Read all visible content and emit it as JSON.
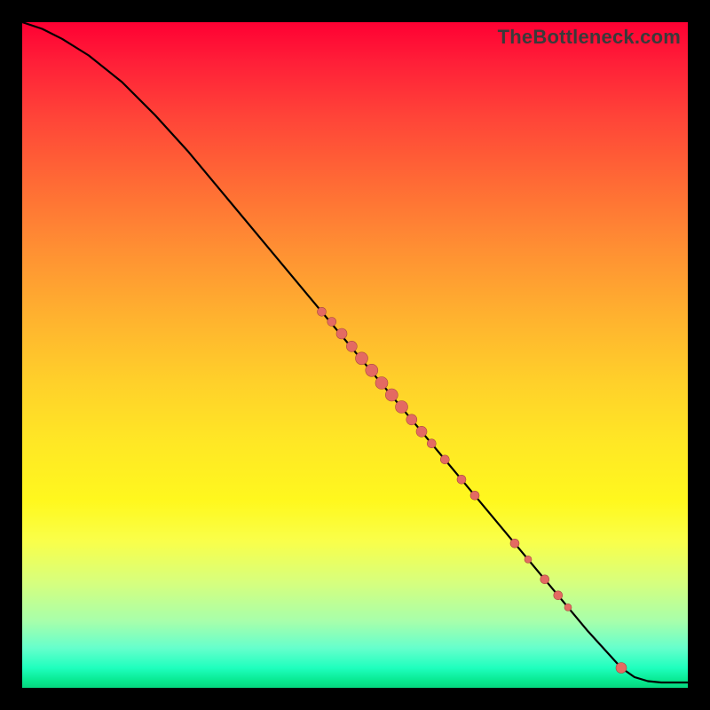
{
  "watermark": "TheBottleneck.com",
  "colors": {
    "dot_fill": "#e46a62",
    "dot_stroke": "#a84840",
    "curve": "#000000",
    "background": "#000000"
  },
  "chart_data": {
    "type": "line",
    "title": "",
    "xlabel": "",
    "ylabel": "",
    "xlim": [
      0,
      100
    ],
    "ylim": [
      0,
      100
    ],
    "grid": false,
    "legend": null,
    "series": [
      {
        "name": "curve",
        "kind": "line",
        "x": [
          0,
          3,
          6,
          10,
          15,
          20,
          25,
          30,
          35,
          40,
          45,
          50,
          55,
          60,
          65,
          70,
          75,
          80,
          85,
          90,
          92,
          94,
          96,
          100
        ],
        "y": [
          100,
          99,
          97.5,
          95,
          91,
          86,
          80.5,
          74.5,
          68.5,
          62.5,
          56.5,
          50.5,
          44.5,
          38.5,
          32.5,
          26.5,
          20.5,
          14.5,
          8.5,
          3.0,
          1.6,
          1.0,
          0.8,
          0.8
        ]
      },
      {
        "name": "points",
        "kind": "scatter",
        "points": [
          {
            "x": 45.0,
            "y": 56.5,
            "r": 5
          },
          {
            "x": 46.5,
            "y": 55.0,
            "r": 5
          },
          {
            "x": 48.0,
            "y": 53.2,
            "r": 6
          },
          {
            "x": 49.5,
            "y": 51.3,
            "r": 6
          },
          {
            "x": 51.0,
            "y": 49.5,
            "r": 7
          },
          {
            "x": 52.5,
            "y": 47.7,
            "r": 7
          },
          {
            "x": 54.0,
            "y": 45.8,
            "r": 7
          },
          {
            "x": 55.5,
            "y": 44.0,
            "r": 7
          },
          {
            "x": 57.0,
            "y": 42.2,
            "r": 7
          },
          {
            "x": 58.5,
            "y": 40.3,
            "r": 6
          },
          {
            "x": 60.0,
            "y": 38.5,
            "r": 6
          },
          {
            "x": 61.5,
            "y": 36.7,
            "r": 5
          },
          {
            "x": 63.5,
            "y": 34.3,
            "r": 5
          },
          {
            "x": 66.0,
            "y": 31.3,
            "r": 5
          },
          {
            "x": 68.0,
            "y": 28.9,
            "r": 5
          },
          {
            "x": 74.0,
            "y": 21.7,
            "r": 5
          },
          {
            "x": 76.0,
            "y": 19.3,
            "r": 4
          },
          {
            "x": 78.5,
            "y": 16.3,
            "r": 5
          },
          {
            "x": 80.5,
            "y": 13.9,
            "r": 5
          },
          {
            "x": 82.0,
            "y": 12.1,
            "r": 4
          },
          {
            "x": 90.0,
            "y": 3.0,
            "r": 6
          }
        ]
      }
    ]
  }
}
